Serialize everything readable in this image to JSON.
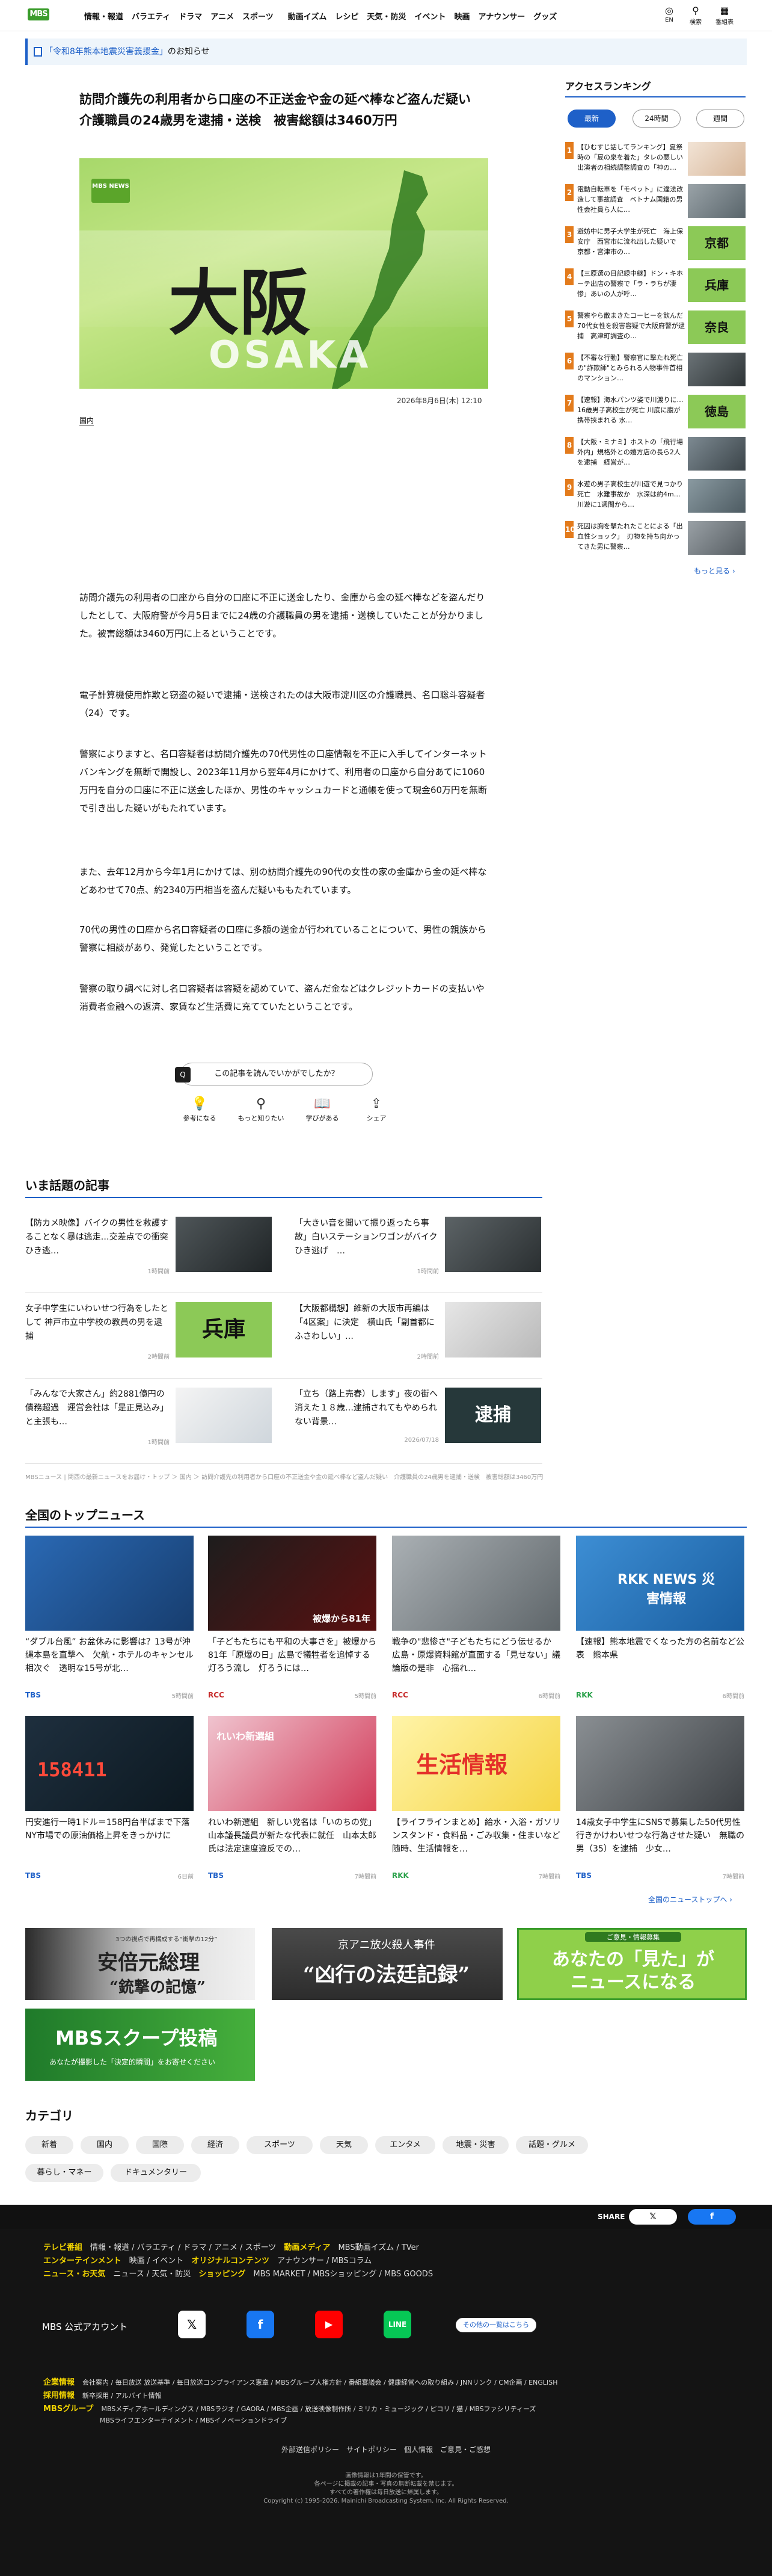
{
  "header": {
    "logo": "MBS",
    "nav": [
      "情報・報道",
      "バラエティ",
      "ドラマ",
      "アニメ",
      "スポーツ",
      "動画イズム",
      "レシピ",
      "天気・防災",
      "イベント",
      "映画",
      "アナウンサー",
      "グッズ"
    ],
    "icons": [
      {
        "name": "globe-icon",
        "label": "EN"
      },
      {
        "name": "search-icon",
        "label": "検索"
      },
      {
        "name": "menu-icon",
        "label": "番組表"
      }
    ]
  },
  "notice": {
    "highlight": "「令和8年熊本地震災害義援金」",
    "rest": "のお知らせ"
  },
  "article": {
    "title": "訪問介護先の利用者から口座の不正送金や金の延べ棒など盗んだ疑い　介護職員の24歳男を逮捕・送検　被害総額は3460万円",
    "hero_text": "大阪",
    "hero_sub": "OSAKA",
    "hero_badge": "MBS NEWS",
    "date": "2026年8月6日(木) 12:10",
    "category": "国内",
    "paragraphs": [
      "訪問介護先の利用者の口座から自分の口座に不正に送金したり、金庫から金の延べ棒などを盗んだりしたとして、大阪府警が今月5日までに24歳の介護職員の男を逮捕・送検していたことが分かりました。被害総額は3460万円に上るということです。",
      "電子計算機使用詐欺と窃盗の疑いで逮捕・送検されたのは大阪市淀川区の介護職員、名口聡斗容疑者（24）です。",
      "警察によりますと、名口容疑者は訪問介護先の70代男性の口座情報を不正に入手してインターネットバンキングを無断で開設し、2023年11月から翌年4月にかけて、利用者の口座から自分あてに1060万円を自分の口座に不正に送金したほか、男性のキャッシュカードと通帳を使って現金60万円を無断で引き出した疑いがもたれています。",
      "また、去年12月から今年1月にかけては、別の訪問介護先の90代の女性の家の金庫から金の延べ棒などあわせて70点、約2340万円相当を盗んだ疑いももたれています。",
      "70代の男性の口座から名口容疑者の口座に多額の送金が行われていることについて、男性の親族から警察に相談があり、発覚したということです。",
      "警察の取り調べに対し名口容疑者は容疑を認めていて、盗んだ金などはクレジットカードの支払いや消費者金融への返済、家賃など生活費に充てていたということです。"
    ]
  },
  "feedback": {
    "question": "この記事を読んでいかがでしたか？",
    "buttons": [
      {
        "icon": "lightbulb-icon",
        "label": "参考になる"
      },
      {
        "icon": "magnifier-icon",
        "label": "もっと知りたい"
      },
      {
        "icon": "book-icon",
        "label": "学びがある"
      },
      {
        "icon": "share-icon",
        "label": "シェア"
      }
    ]
  },
  "ranking": {
    "title": "アクセスランキング",
    "tabs": [
      "最新",
      "24時間",
      "週間"
    ],
    "items": [
      {
        "rank": "1",
        "text": "【ひむすじ話してランキング】夏祭時の「夏の泉を着た」タレの悪しい出演者の相続調整調査の「神の…"
      },
      {
        "rank": "2",
        "text": "電動自転車を「モペット」に違法改造して事故調査　ベトナム国籍の男性会社員ら人に…"
      },
      {
        "rank": "3",
        "text": "避妨中に男子大学生が死亡　海上保安庁　西宮市に流れ出した疑いで　京都・宮津市の…"
      },
      {
        "rank": "4",
        "text": "【三原選の日記録中継】ドン・キホーテ出店の警察で「ラ・ラちが凄惨」あいの人が呼…"
      },
      {
        "rank": "5",
        "text": "警察やら散まきたコーヒーを飲んだ70代女性を殺害容疑で大阪府警が逮捕　高津町調査の…"
      },
      {
        "rank": "6",
        "text": "【不審な行動】警察官に撃たれ死亡の\"詐欺師\"とみられる人物事件首相のマンション…"
      },
      {
        "rank": "7",
        "text": "【速報】海水パンツ姿で川渡りに…16歳男子高校生が死亡 川底に腹が携帯挟まれる 水…"
      },
      {
        "rank": "8",
        "text": "【大阪・ミナミ】ホストの「飛行場外内」規格外との嬉方店の長ら2人を逮捕　経営が…"
      },
      {
        "rank": "9",
        "text": "水遊の男子高校生が川遊で見つかり死亡　水難事故か　水深は約4m…川遊に1週間から…"
      },
      {
        "rank": "10",
        "text": "死因は胸を撃たれたことによる「出血性ショック」　刃物を持ち向かってきた男に警察…"
      }
    ],
    "more": "もっと見る"
  },
  "topics": {
    "title": "いま話題の記事",
    "items": [
      {
        "title": "【防カメ映像】バイクの男性を救護することなく暴は逃走…交差点での衝突ひき逃…",
        "date": "1時間前"
      },
      {
        "title": "「大きい音を聞いて振り返ったら事故」白いステーションワゴンがバイクひき逃げ　…",
        "date": "1時間前"
      },
      {
        "title": "女子中学生にいわいせつ行為をしたとして 神戸市立中学校の教員の男を逮捕",
        "date": "2時間前"
      },
      {
        "title": "【大阪都構想】維新の大阪市再編は「4区案」に決定　横山氏「副首都にふさわしい」…",
        "date": "2時間前"
      },
      {
        "title": "「みんなで大家さん」約2881億円の債務超過　運営会社は「是正見込み」と主張も…",
        "date": "1時間前"
      },
      {
        "title": "「立ち（路上売春）します」夜の街へ消えた１８歳…逮捕されてもやめられない背景…",
        "date": "2026/07/18"
      }
    ]
  },
  "breadcrumb": "MBSニュース | 関西の最新ニュースをお届け・トップ ＞ 国内 ＞ 訪問介護先の利用者から口座の不正送金や金の延べ棒など盗んだ疑い　介護職員の24歳男を逮捕・送検　被害総額は3460万円",
  "national": {
    "title": "全国のトップニュース",
    "items": [
      {
        "title": "“ダブル台風” お盆休みに影響は？13号が沖縄本島を直撃へ　欠航・ホテルのキャンセル相次ぐ　透明な15号が北…",
        "src": "TBS",
        "date": "5時間前",
        "img_text": ""
      },
      {
        "title": "「子どもたちにも平和の大事さを」被爆から81年「原爆の日」広島で犠牲者を追悼する灯ろう流し　灯ろうには…",
        "src": "RCC",
        "date": "5時間前",
        "img_text": "被爆から81年"
      },
      {
        "title": "戦争の\"悲惨さ\"子どもたちにどう伝せるか 広島・原爆資料館が直面する「見せない」議論版の是非　心揺れ…",
        "src": "RCC",
        "date": "6時間前",
        "img_text": ""
      },
      {
        "title": "【速報】熊本地震でくなった方の名前など公表　熊本県",
        "src": "RKK",
        "date": "6時間前",
        "img_text": "RKK NEWS 災害情報"
      },
      {
        "title": "円安進行一時1ドル＝158円台半ばまで下落　NY市場での原油価格上昇をきっかけに",
        "src": "TBS",
        "date": "6日前",
        "img_text": "158411"
      },
      {
        "title": "れいわ新選組　新しい党名は「いのちの党」山本議長議員が新たな代表に就任　山本太郎氏は法定速度違反での…",
        "src": "TBS",
        "date": "7時間前",
        "img_text": "れいわ新選組"
      },
      {
        "title": "【ライフラインまとめ】給水・入浴・ガソリンスタンド・食料品・ごみ収集・住まいなど　随時、生活情報を…",
        "src": "RKK",
        "date": "7時間前",
        "img_text": "生活情報"
      },
      {
        "title": "14歳女子中学生にSNSで募集した50代男性行きかけわいせつな行為させた疑い　無職の男（35）を逮捕　少女…",
        "src": "TBS",
        "date": "7時間前",
        "img_text": ""
      }
    ],
    "more": "全国のニューストップへ"
  },
  "banners": [
    {
      "line1": "3つの視点で再構成する“衝撃の12分”",
      "line2": "安倍元総理",
      "line3": "“銃撃の記憶”"
    },
    {
      "line1": "京アニ放火殺人事件",
      "line2": "“凶行の法廷記録”"
    },
    {
      "line1": "ご意見・情報募集",
      "line2": "あなたの「見た」が",
      "line3": "ニュースになる"
    },
    {
      "line1": "MBSスクープ投稿",
      "line2": "あなたが撮影した「決定的瞬間」をお寄せください"
    }
  ],
  "categories": {
    "title": "カテゴリ",
    "items": [
      "新着",
      "国内",
      "国際",
      "経済",
      "スポーツ",
      "天気",
      "エンタメ",
      "地震・災害",
      "話題・グルメ",
      "暮らし・マネー",
      "ドキュメンタリー"
    ]
  },
  "footer": {
    "share_label": "SHARE",
    "rows": [
      {
        "head": "テレビ番組",
        "links": "情報・報道 / バラエティ / ドラマ / アニメ / スポーツ",
        "head2": "動画メディア",
        "links2": "MBS動画イズム / TVer"
      },
      {
        "head": "エンターテインメント",
        "links": "映画 / イベント",
        "head2": "オリジナルコンテンツ",
        "links2": "アナウンサー / MBSコラム"
      },
      {
        "head": "ニュース・お天気",
        "links": "ニュース / 天気・防災",
        "head2": "ショッピング",
        "links2": "MBS MARKET / MBSショッピング / MBS GOODS"
      }
    ],
    "account_label": "MBS 公式アカウント",
    "account_more": "その他の一覧はこちら",
    "corp_rows": [
      {
        "head": "企業情報",
        "links": "会社案内 / 毎日放送 放送基準 / 毎日放送コンプライアンス憲章 / MBSグループ人権方針 / 番組審議会 / 健康経営への取り組み / JNNリンク / CM企画 / ENGLISH"
      },
      {
        "head": "採用情報",
        "links": "新卒採用 / アルバイト情報"
      },
      {
        "head": "MBSグループ",
        "links": "MBSメディアホールディングス / MBSラジオ / GAORA / MBS企画 / 放送映像制作所 / ミリカ・ミュージック / ピコリ / 猫 / MBSファシリティーズ"
      },
      {
        "head": "",
        "links": "MBSライフエンターテイメント / MBSイノベーションドライブ"
      }
    ],
    "bottom_links": "外部送信ポリシー　サイトポリシー　個人情報　ご意見・ご感想",
    "copyright": [
      "画像情報は1年間の保管です。",
      "各ページに掲載の記事・写真の無断転載を禁じます。",
      "すべての著作権は毎日放送に帰属します。",
      "Copyright (c) 1995-2026, Mainichi Broadcasting System, Inc. All Rights Reserved."
    ]
  }
}
